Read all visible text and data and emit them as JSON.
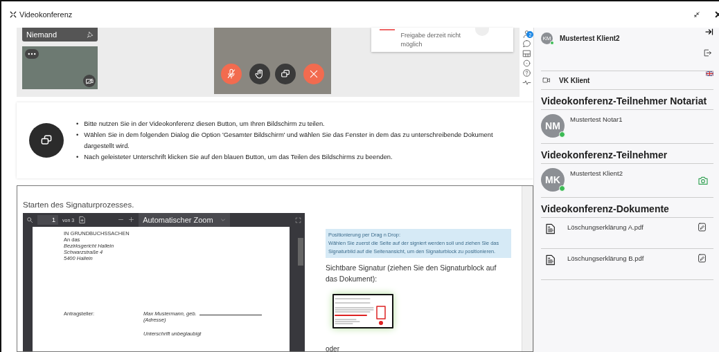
{
  "window": {
    "title": "Videokonferenz"
  },
  "video": {
    "speaker_tile": {
      "name": "Niemand"
    },
    "notification": {
      "text": "Freigabe derzeit nicht möglich"
    },
    "participant_count": "2",
    "controls": [
      {
        "kind": "mute",
        "color": "#f26b4f"
      },
      {
        "kind": "hand",
        "color": "#3a3a3a"
      },
      {
        "kind": "share",
        "color": "#3a3a3a"
      },
      {
        "kind": "leave",
        "color": "#f26b4f"
      }
    ]
  },
  "instructions": {
    "bullets": [
      {
        "marker": "•",
        "text": "Bitte nutzen Sie in der Videokonferenz diesen Button, um Ihren Bildschirm zu teilen."
      },
      {
        "marker": "•",
        "text": "Wählen Sie in dem folgenden Dialog die Option 'Gesamter Bildschirm' und wählen Sie das Fenster in dem das zu unterschreibende Dokument dargestellt wird."
      },
      {
        "marker": "•",
        "text": "Nach geleisteter Unterschrift klicken Sie auf den blauen Button, um das Teilen des Bildschirms zu beenden."
      }
    ]
  },
  "signature": {
    "heading": "Starten des Signaturprozesses.",
    "viewer": {
      "page": "1",
      "page_count": "von 3",
      "zoom": "Automatischer Zoom",
      "address": [
        {
          "text": "IN GRUNDBUCHSSACHEN",
          "italic": false
        },
        {
          "text": "An das",
          "italic": false
        },
        {
          "text": "Bezirksgericht Hallein",
          "italic": true
        },
        {
          "text": "Schwarzstraße 4",
          "italic": true
        },
        {
          "text": "5400 Hallein",
          "italic": true
        }
      ],
      "applicant_label": "Antragsteller:",
      "applicant_name": "Max Mustermann, geb.",
      "applicant_address": "(Adresse)",
      "signature_note": "Unterschrift unbeglaubigt"
    },
    "hint": {
      "title": "Positionierung per Drag n Drop:",
      "text": "Wählen Sie zuerst die Seite auf der signiert werden soll und ziehen Sie das Signaturbild auf die Seitenansicht, um den Signaturblock zu positionieren."
    },
    "visible_signature_label": "Sichtbare Signatur (ziehen Sie den Signaturblock auf das Dokument):",
    "or": "oder"
  },
  "sidebar": {
    "user": {
      "initials": "KM",
      "name": "Mustertest Klient2",
      "online": true
    },
    "room": {
      "name": "VK Klient"
    },
    "sections": [
      {
        "kind": "participants",
        "title": "Videokonferenz-Teilnehmer Notariat",
        "items": [
          {
            "initials": "NM",
            "name": "Mustertest Notar1",
            "online": true,
            "camera": false
          }
        ]
      },
      {
        "kind": "participants",
        "title": "Videokonferenz-Teilnehmer",
        "items": [
          {
            "initials": "MK",
            "name": "Mustertest Klient2",
            "online": true,
            "camera": true
          }
        ]
      },
      {
        "kind": "documents",
        "title": "Videokonferenz-Dokumente",
        "items": [
          {
            "name": "Löschungserklärung A.pdf"
          },
          {
            "name": "Löschungserklärung B.pdf"
          }
        ]
      }
    ]
  }
}
